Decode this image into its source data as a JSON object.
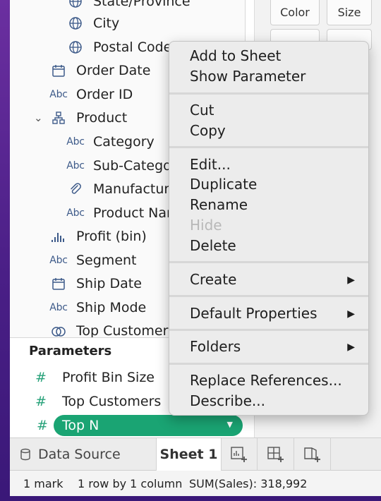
{
  "data_pane": {
    "fields": [
      {
        "label": "State/Province",
        "icon": "globe-icon",
        "indent": 2
      },
      {
        "label": "City",
        "icon": "globe-icon",
        "indent": 2
      },
      {
        "label": "Postal Code",
        "icon": "globe-icon",
        "indent": 2
      },
      {
        "label": "Order Date",
        "icon": "calendar-icon",
        "indent": 1
      },
      {
        "label": "Order ID",
        "icon": "abc-icon",
        "indent": 1
      },
      {
        "label": "Product",
        "icon": "hierarchy-icon",
        "indent": 1
      },
      {
        "label": "Category",
        "icon": "abc-icon",
        "indent": 2
      },
      {
        "label": "Sub-Category",
        "icon": "abc-icon",
        "indent": 2
      },
      {
        "label": "Manufacturer",
        "icon": "paperclip-icon",
        "indent": 2
      },
      {
        "label": "Product Name",
        "icon": "abc-icon",
        "indent": 2
      },
      {
        "label": "Profit (bin)",
        "icon": "bin-histogram-icon",
        "indent": 1
      },
      {
        "label": "Segment",
        "icon": "abc-icon",
        "indent": 1
      },
      {
        "label": "Ship Date",
        "icon": "calendar-icon",
        "indent": 1
      },
      {
        "label": "Ship Mode",
        "icon": "abc-icon",
        "indent": 1
      },
      {
        "label": "Top Customers",
        "icon": "set-icon",
        "indent": 1
      }
    ],
    "abc_text": "Abc"
  },
  "marks_card": {
    "color_label": "Color",
    "size_label": "Size"
  },
  "parameters": {
    "title": "Parameters",
    "items": [
      {
        "label": "Profit Bin Size"
      },
      {
        "label": "Top Customers"
      }
    ],
    "selected": "Top N",
    "hash": "#"
  },
  "tabs": {
    "data_source": "Data Source",
    "sheet": "Sheet 1"
  },
  "status": {
    "marks": "1 mark",
    "dims": "1 row by 1 column",
    "sum": "SUM(Sales): 318,992"
  },
  "context_menu": {
    "groups": [
      [
        {
          "label": "Add to Sheet"
        },
        {
          "label": "Show Parameter"
        }
      ],
      [
        {
          "label": "Cut"
        },
        {
          "label": "Copy"
        }
      ],
      [
        {
          "label": "Edit..."
        },
        {
          "label": "Duplicate"
        },
        {
          "label": "Rename"
        },
        {
          "label": "Hide",
          "disabled": true
        },
        {
          "label": "Delete"
        }
      ],
      [
        {
          "label": "Create",
          "submenu": true
        }
      ],
      [
        {
          "label": "Default Properties",
          "submenu": true
        }
      ],
      [
        {
          "label": "Folders",
          "submenu": true
        }
      ],
      [
        {
          "label": "Replace References..."
        },
        {
          "label": "Describe..."
        }
      ]
    ]
  },
  "colors": {
    "parameter_green": "#1aa473",
    "icon_blue": "#3d5a89"
  }
}
